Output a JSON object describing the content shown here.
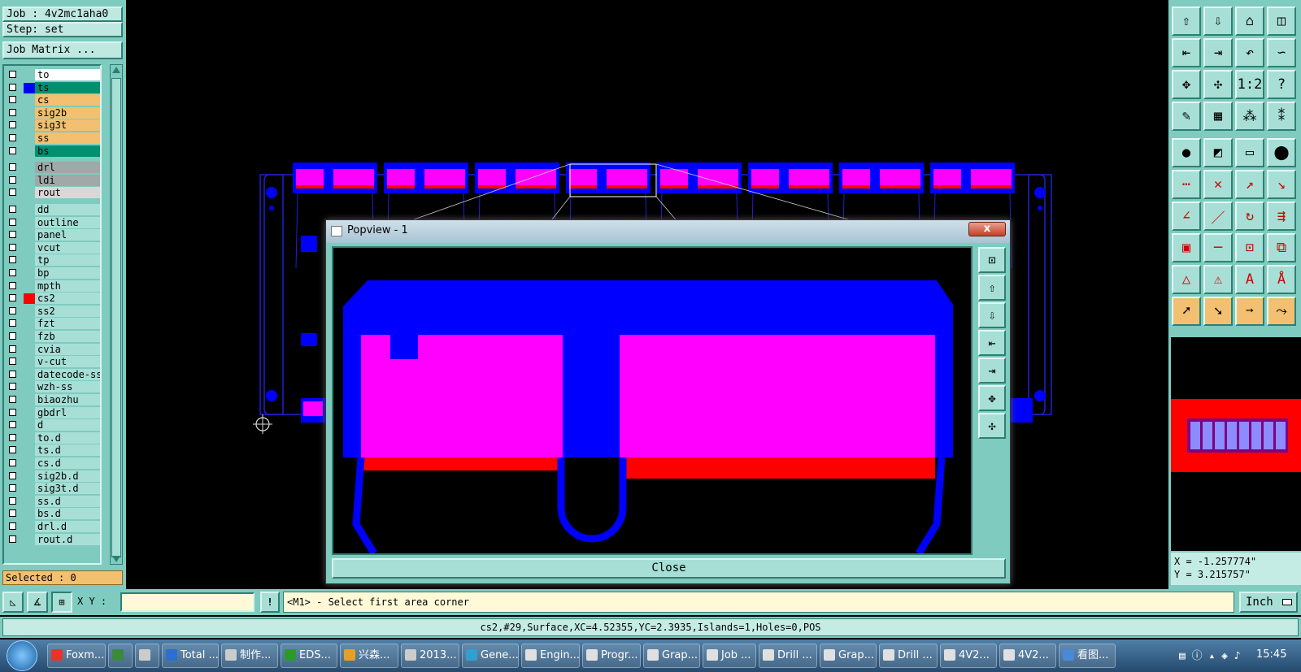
{
  "job_label": "Job : 4v2mc1aha0",
  "step_label": "Step: set",
  "job_matrix_button": "Job Matrix ...",
  "layers": [
    {
      "name": "to",
      "color": "#ffffff",
      "sw": ""
    },
    {
      "name": "ts",
      "color": "#009070",
      "sw": "#0000ff"
    },
    {
      "name": "cs",
      "color": "#f2c070",
      "sw": ""
    },
    {
      "name": "sig2b",
      "color": "#f2c070",
      "sw": ""
    },
    {
      "name": "sig3t",
      "color": "#f2c070",
      "sw": ""
    },
    {
      "name": "ss",
      "color": "#f2c070",
      "sw": ""
    },
    {
      "name": "bs",
      "color": "#009070",
      "sw": ""
    },
    {
      "name": "drl",
      "color": "#a0a8a8",
      "sw": ""
    },
    {
      "name": "ldi",
      "color": "#a0a8a8",
      "sw": ""
    },
    {
      "name": "rout",
      "color": "#d8d8d8",
      "sw": ""
    },
    {
      "name": "dd",
      "color": "#a7dfd6",
      "sw": ""
    },
    {
      "name": "outline",
      "color": "#a7dfd6",
      "sw": ""
    },
    {
      "name": "panel",
      "color": "#a7dfd6",
      "sw": ""
    },
    {
      "name": "vcut",
      "color": "#a7dfd6",
      "sw": ""
    },
    {
      "name": "tp",
      "color": "#a7dfd6",
      "sw": ""
    },
    {
      "name": "bp",
      "color": "#a7dfd6",
      "sw": ""
    },
    {
      "name": "mpth",
      "color": "#a7dfd6",
      "sw": ""
    },
    {
      "name": "cs2",
      "color": "#a7dfd6",
      "sw": "#ff0000"
    },
    {
      "name": "ss2",
      "color": "#a7dfd6",
      "sw": ""
    },
    {
      "name": "fzt",
      "color": "#a7dfd6",
      "sw": ""
    },
    {
      "name": "fzb",
      "color": "#a7dfd6",
      "sw": ""
    },
    {
      "name": "cvia",
      "color": "#a7dfd6",
      "sw": ""
    },
    {
      "name": "v-cut",
      "color": "#a7dfd6",
      "sw": ""
    },
    {
      "name": "datecode-ss",
      "color": "#a7dfd6",
      "sw": ""
    },
    {
      "name": "wzh-ss",
      "color": "#a7dfd6",
      "sw": ""
    },
    {
      "name": "biaozhu",
      "color": "#a7dfd6",
      "sw": ""
    },
    {
      "name": "gbdrl",
      "color": "#a7dfd6",
      "sw": ""
    },
    {
      "name": "d",
      "color": "#a7dfd6",
      "sw": ""
    },
    {
      "name": "to.d",
      "color": "#a7dfd6",
      "sw": ""
    },
    {
      "name": "ts.d",
      "color": "#a7dfd6",
      "sw": ""
    },
    {
      "name": "cs.d",
      "color": "#a7dfd6",
      "sw": ""
    },
    {
      "name": "sig2b.d",
      "color": "#a7dfd6",
      "sw": ""
    },
    {
      "name": "sig3t.d",
      "color": "#a7dfd6",
      "sw": ""
    },
    {
      "name": "ss.d",
      "color": "#a7dfd6",
      "sw": ""
    },
    {
      "name": "bs.d",
      "color": "#a7dfd6",
      "sw": ""
    },
    {
      "name": "drl.d",
      "color": "#a7dfd6",
      "sw": ""
    },
    {
      "name": "rout.d",
      "color": "#a7dfd6",
      "sw": ""
    }
  ],
  "selected_label": "Selected : 0",
  "popview": {
    "title": "Popview - 1",
    "close_x": "x",
    "close_button": "Close"
  },
  "toolbar_glyphs": [
    "⇧",
    "⇩",
    "⌂",
    "◫",
    "⇤",
    "⇥",
    "↶",
    "∽",
    "✥",
    "✣",
    "1:2",
    "?",
    "✎",
    "▦",
    "⁂",
    "⁑",
    "●",
    "◩",
    "▭",
    "⬤",
    "⋯",
    "✕",
    "↗",
    "↘",
    "∠",
    "／",
    "↻",
    "⇶",
    "▣",
    "─",
    "⊡",
    "⧉",
    "△",
    "⚠",
    "A",
    "Å",
    "➚",
    "➘",
    "➙",
    "⤳"
  ],
  "coords": {
    "x": "X = -1.257774\"",
    "y": "Y = 3.215757\""
  },
  "cmd": {
    "xy_label": "X Y :",
    "xy_value": "",
    "excl": "!",
    "prompt": "<M1> - Select first area corner",
    "unit": "Inch"
  },
  "status": "cs2,#29,Surface,XC=4.52355,YC=2.3935,Islands=1,Holes=0,POS",
  "taskbar": {
    "items": [
      "Foxm...",
      "",
      "",
      "Total ...",
      "制作...",
      "EDS...",
      "兴森...",
      "2013...",
      "Gene...",
      "Engin...",
      "Progr...",
      "Grap...",
      "Job ...",
      "Drill ...",
      "Grap...",
      "Drill ...",
      "4V2...",
      "4V2...",
      "看图..."
    ],
    "clock": "15:45"
  },
  "colors": {
    "panel": "#7fcbc0",
    "blue": "#0000ff",
    "magenta": "#ff00ff",
    "red": "#ff0000"
  }
}
